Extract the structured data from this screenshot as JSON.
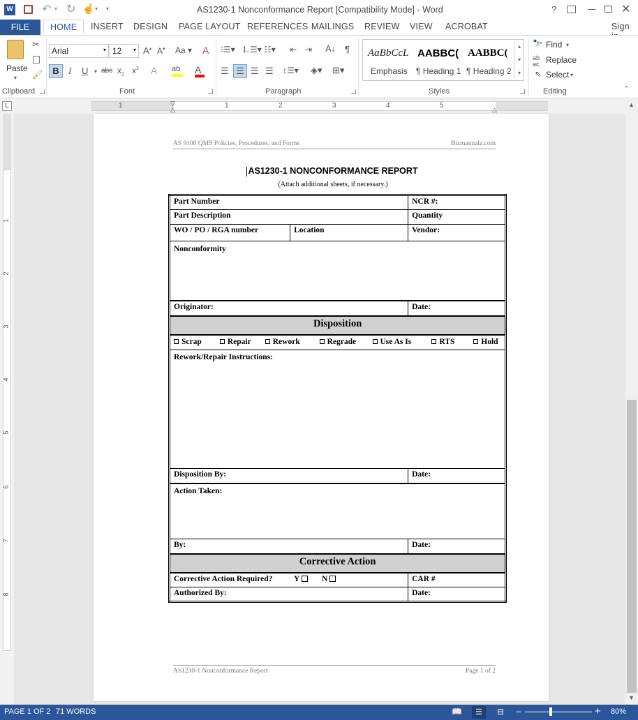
{
  "window": {
    "title": "AS1230-1 Nonconformance Report [Compatibility Mode] - Word",
    "help": "?",
    "signin": "Sign in"
  },
  "tabs": [
    "FILE",
    "HOME",
    "INSERT",
    "DESIGN",
    "PAGE LAYOUT",
    "REFERENCES",
    "MAILINGS",
    "REVIEW",
    "VIEW",
    "ACROBAT"
  ],
  "ribbon": {
    "clipboard": {
      "label": "Clipboard",
      "paste": "Paste"
    },
    "font": {
      "label": "Font",
      "name": "Arial",
      "size": "12"
    },
    "paragraph": {
      "label": "Paragraph"
    },
    "styles": {
      "label": "Styles",
      "items": [
        {
          "preview": "AaBbCcL",
          "name": "Emphasis"
        },
        {
          "preview": "AABBC(",
          "name": "¶ Heading 1"
        },
        {
          "preview": "AABBC(",
          "name": "¶ Heading 2"
        }
      ]
    },
    "editing": {
      "label": "Editing",
      "find": "Find",
      "replace": "Replace",
      "select": "Select"
    }
  },
  "ruler": {
    "numbers": [
      "1",
      "1",
      "2",
      "3",
      "4",
      "5"
    ]
  },
  "vruler": {
    "numbers": [
      "1",
      "2",
      "3",
      "4",
      "5",
      "6",
      "7",
      "8"
    ]
  },
  "document": {
    "header_left": "AS 9100 QMS Policies, Procedures, and Forms",
    "header_right": "Bizmanualz.com",
    "title": "AS1230-1 NONCONFORMANCE REPORT",
    "subtitle": "(Attach additional sheets, if necessary.)",
    "form": {
      "part_number": "Part Number",
      "ncr": "NCR #:",
      "part_description": "Part Description",
      "quantity": "Quantity",
      "wo_po_rga": "WO / PO / RGA number",
      "location": "Location",
      "vendor": "Vendor:",
      "nonconformity": "Nonconformity",
      "originator": "Originator:",
      "date": "Date:",
      "disposition": "Disposition",
      "options": [
        "Scrap",
        "Repair",
        "Rework",
        "Regrade",
        "Use As Is",
        "RTS",
        "Hold"
      ],
      "rework_instructions": "Rework/Repair Instructions:",
      "disposition_by": "Disposition By:",
      "action_taken": "Action Taken:",
      "by": "By:",
      "corrective_action": "Corrective Action",
      "ca_required": "Corrective Action Required?",
      "yes": "Y",
      "no": "N",
      "car": "CAR #",
      "authorized_by": "Authorized By:"
    },
    "footer_left": "AS1230-1 Nonconformance Report",
    "footer_right": "Page 1 of 2"
  },
  "status": {
    "page": "PAGE 1 OF 2",
    "words": "71 WORDS",
    "zoom": "80%"
  },
  "colors": {
    "accent": "#2b579a"
  }
}
